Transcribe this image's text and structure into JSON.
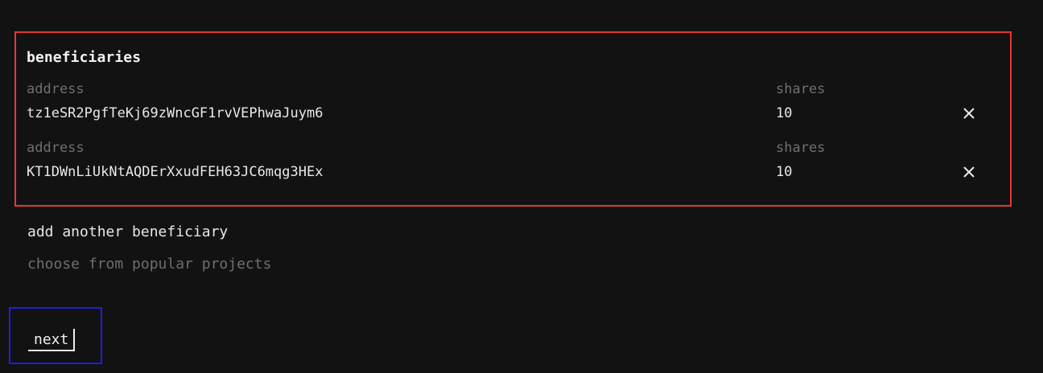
{
  "beneficiaries": {
    "title": "beneficiaries",
    "rows": [
      {
        "address_label": "address",
        "address": "tz1eSR2PgfTeKj69zWncGF1rvVEPhwaJuym6",
        "shares_label": "shares",
        "shares": "10",
        "remove_icon": "close-icon"
      },
      {
        "address_label": "address",
        "address": "KT1DWnLiUkNtAQDErXxudFEH63JC6mqg3HEx",
        "shares_label": "shares",
        "shares": "10",
        "remove_icon": "close-icon"
      }
    ]
  },
  "actions": {
    "add_beneficiary": "add another beneficiary",
    "choose_popular": "choose from popular projects",
    "next": "next"
  },
  "colors": {
    "background": "#121212",
    "highlight_red": "#e53935",
    "highlight_blue": "#1e1ee6",
    "text": "#e8e8e8",
    "muted": "#6f6f6f"
  }
}
